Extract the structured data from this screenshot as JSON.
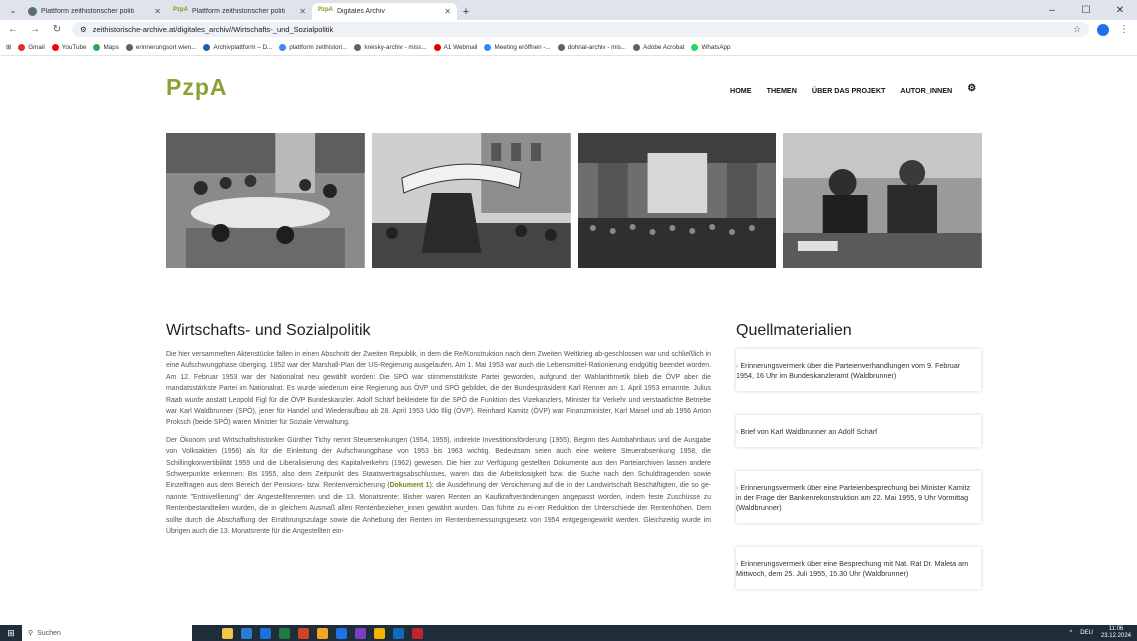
{
  "browser": {
    "tabs": [
      {
        "title": "Plattform zeithistorischer politi",
        "active": false,
        "icon": "globe-icon"
      },
      {
        "title": "Plattform zeithistorischer politi",
        "active": false,
        "icon": "pzpa-favicon"
      },
      {
        "title": "Digitales Archiv",
        "active": true,
        "icon": "pzpa-favicon"
      }
    ],
    "favicon_text": "PzpA",
    "url": "zeithistorische-archive.at/digitales_archiv//Wirtschafts-_und_Sozialpolitik",
    "bookmarks": [
      {
        "label": "Gmail",
        "color": "#d93025"
      },
      {
        "label": "YouTube",
        "color": "#ff0000"
      },
      {
        "label": "Maps",
        "color": "#34a853"
      },
      {
        "label": "erinnerungsort wien...",
        "color": "#5f6368"
      },
      {
        "label": "Archivplattform – D...",
        "color": "#1a5fb4"
      },
      {
        "label": "plattform zeithistori...",
        "color": "#4285f4"
      },
      {
        "label": "kreisky-archiv - miss...",
        "color": "#5f6368"
      },
      {
        "label": "A1 Webmail",
        "color": "#e00000"
      },
      {
        "label": "Meeting eröffnen -...",
        "color": "#2d8cff"
      },
      {
        "label": "dohnal-archiv - mis...",
        "color": "#5f6368"
      },
      {
        "label": "Adobe Acrobat",
        "color": "#5f6368"
      },
      {
        "label": "WhatsApp",
        "color": "#25d366"
      }
    ]
  },
  "site": {
    "logo": "PzpA",
    "nav": [
      "HOME",
      "THEMEN",
      "ÜBER DAS PROJEKT",
      "AUTOR_INNEN"
    ],
    "accent": "#8aa235"
  },
  "article": {
    "title": "Wirtschafts- und Sozialpolitik",
    "p1": "Die hier versammelten Aktenstücke fallen in einen Abschnitt der Zweiten Republik, in dem die Re/Konstruktion nach dem Zweiten Weltkrieg ab-geschlossen war und schließlich in eine Aufschwungphase überging. 1952 war der Marshall-Plan der US-Regierung ausgelaufen. Am 1. Mai 1953 war auch die Lebensmittel-Rationierung endgültig beendet worden. Am 12. Februar 1953 war der Nationalrat neu gewählt worden: Die SPÖ war stimmenstärkste Partei geworden, aufgrund der Wahlarithmetik blieb die ÖVP aber die mandatsstärkste Partei im Nationalrat. Es wurde wiederum eine Regierung aus ÖVP und SPÖ gebildet, die der Bundespräsident Karl Renner am 1. April 1953 ernannte. Julius Raab wurde anstatt Leopold Figl für die ÖVP Bundeskanzler. Adolf Schärf bekleidete für die SPÖ die Funktion des Vizekanzlers, Minister für Verkehr und verstaatlichte Betriebe war Karl Waldbrunner (SPÖ), jener für Handel und Wiederaufbau ab 28. April 1953 Udo Illig (ÖVP). Reinhard Kamitz (ÖVP) war Finanzminister, Karl Maisel und ab 1956 Anton Proksch (beide SPÖ) waren Minister für Soziale Verwaltung.",
    "p2a": "Der Ökonom und Wirtschaftshistoriker Günther Tichy nennt Steuersenkungen (1954, 1955), indirekte Investitionsförderung (1955), Beginn des Autobahnbaus und die Ausgabe von Volksaktien (1956) als für die Einleitung der Aufschwungphase von 1953 bis 1963 wichtig. Bedeutsam seien auch eine weitere Steuerabsenkung 1958, die Schillingkonvertibilität 1959 und die Liberalisierung des Kapitalverkehrs (1962) gewesen. Die hier zur Verfügung gestellten Dokumente aus den Parteiarchiven lassen andere Schwerpunkte erkennen: Bis 1955, also dem Zeitpunkt des Staatsvertragsabschlusses, waren das die Arbeitslosigkeit bzw. die Suche nach den Schuldtragenden sowie Einzelfragen aus dem Bereich der Pensions- bzw. Rentenversicherung (",
    "doc_link": "Dokument 1",
    "p2b": "): die Ausdehnung der Versicherung auf die in der Landwirtschaft Beschäftigten, die so ge-nannte \"Entnivellierung\" der Angestelltenrenten und die 13. Monatsrente: Bisher waren Renten an Kaufkraftveränderungen angepasst worden, indem feste Zuschüsse zu Rentenbestandteilen wurden, die in gleichem Ausmaß allen Rentenbezieher_innen gewährt wurden. Das führte zu ei-ner Reduktion der Unterschiede der Rentenhöhen. Dem sollte durch die Abschaffung der Ernährungszulage sowie die Anhebung der Renten im Rentenbemessungsgesetz von 1954 entgegengewirkt werden. Gleichzeitig wurde im Übrigen auch die 13. Monatsrente für die Angestellten ein-"
  },
  "sources": {
    "title": "Quellmaterialien",
    "items": [
      "Erinnerungsvermerk über die Parteienverhandlungen vom 9. Februar 1954, 16 Uhr im Bundeskanzleramt (Waldbrunner)",
      "Brief von Karl Waldbrunner an Adolf Schärf",
      "Erinnerungsvermerk über eine Parteienbesprechung bei Minister Kamitz in der Frage der Bankenrekonstruktion am 22. Mai 1955, 9 Uhr Vormittag (Waldbrunner)",
      "Erinnerungsvermerk über eine Besprechung mit Nat. Rat Dr. Maleta am Mittwoch, dem 25. Juli 1955, 15.30 Uhr (Waldbrunner)"
    ]
  },
  "taskbar": {
    "search_placeholder": "Suchen",
    "lang": "DEU",
    "time": "11:06",
    "date": "23.12.2024",
    "apps": [
      "#f2c744",
      "#2b7cd3",
      "#1e6fd9",
      "#1d7a45",
      "#d04423",
      "#f5a623",
      "#1a73e8",
      "#7b3fbf",
      "#f4b400",
      "#0f6cbd",
      "#c0262d"
    ]
  }
}
